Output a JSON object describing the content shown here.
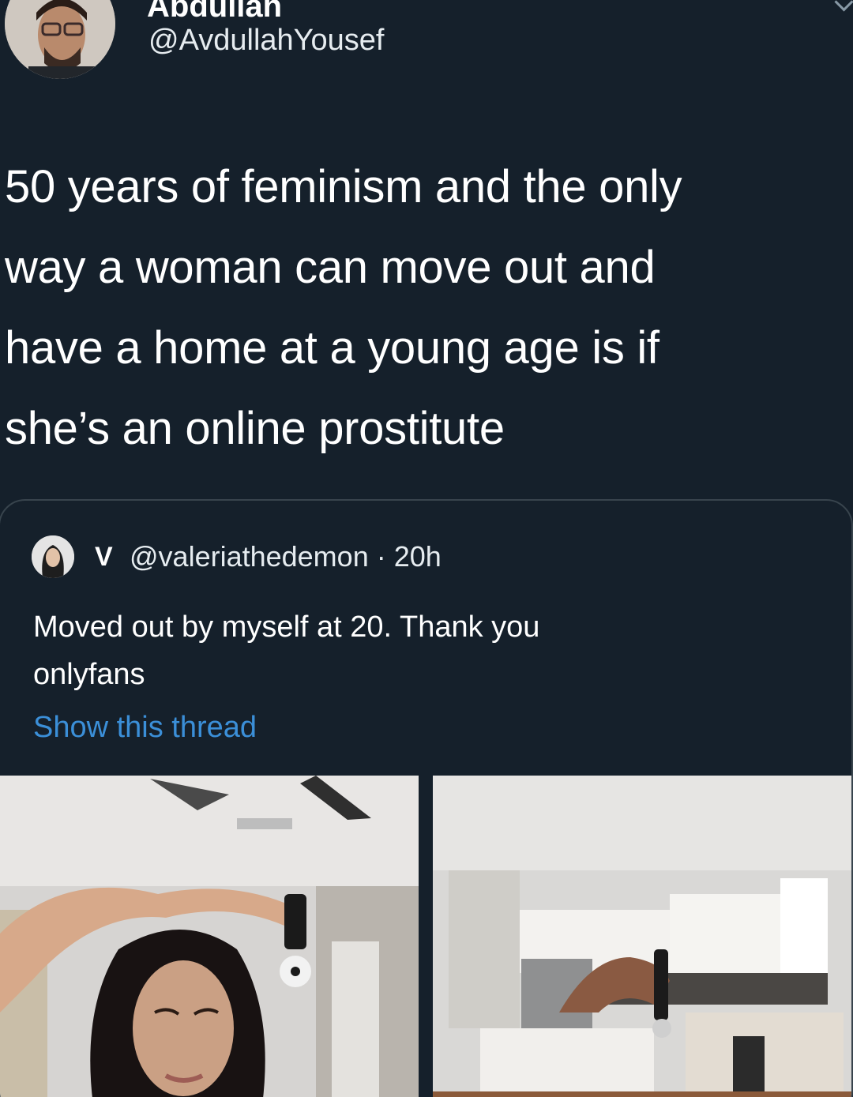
{
  "tweet": {
    "display_name": "Abdullah",
    "handle": "@AvdullahYousef",
    "text_lines": [
      "50 years of feminism and the only",
      "way a woman can move out and",
      "have a home at a young age is if",
      "she’s an online prostitute"
    ]
  },
  "quoted_tweet": {
    "name": "V",
    "handle": "@valeriathedemon",
    "separator": "·",
    "time": "20h",
    "text_lines": [
      "Moved out by myself at 20. Thank you",
      "onlyfans"
    ],
    "show_thread": "Show this thread",
    "media": [
      "woman-holding-keys-photo",
      "kitchen-keys-photo"
    ]
  },
  "colors": {
    "background": "#15202b",
    "text": "#ffffff",
    "link": "#3b8fd8",
    "border": "#38444d"
  },
  "icons": [
    "chevron-down-icon"
  ]
}
